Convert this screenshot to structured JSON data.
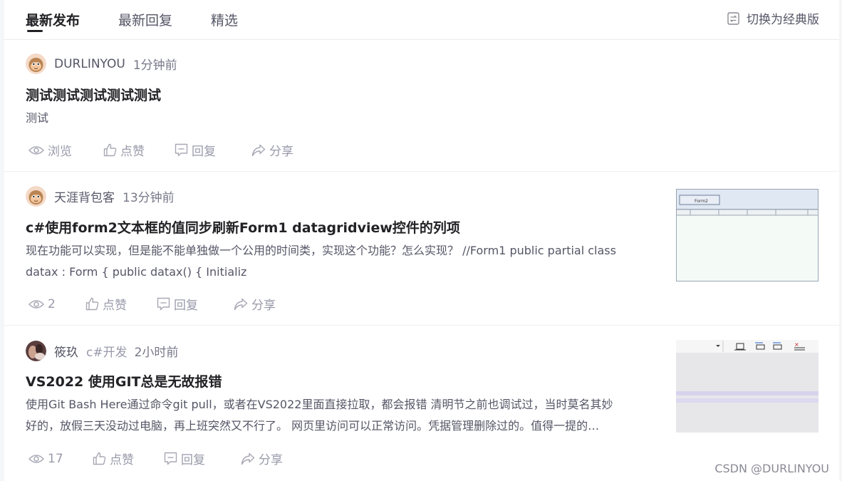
{
  "tabs": [
    "最新发布",
    "最新回复",
    "精选"
  ],
  "switch_label": "切换为经典版",
  "posts": [
    {
      "author": "DURLINYOU",
      "topic": "",
      "time": "1分钟前",
      "title": "测试测试测试测试测试",
      "excerpt": "测试",
      "views": "浏览",
      "like": "点赞",
      "reply": "回复",
      "share": "分享"
    },
    {
      "author": "天涯背包客",
      "topic": "",
      "time": "13分钟前",
      "title": "c#使用form2文本框的值同步刷新Form1 datagridview控件的列项",
      "excerpt_line1": "现在功能可以实现，但是能不能单独做一个公用的时间类，实现这个功能？怎么实现？ //Form1 public partial class",
      "excerpt_line2": "datax : Form { public datax() { Initializ",
      "views": "2",
      "like": "点赞",
      "reply": "回复",
      "share": "分享",
      "thumb_button": "Form2"
    },
    {
      "author": "筱玖",
      "topic": "c#开发",
      "time": "2小时前",
      "title": "VS2022 使用GIT总是无故报错",
      "excerpt_line1": "使用Git Bash Here通过命令git pull，或者在VS2022里面直接拉取，都会报错 清明节之前也调试过，当时莫名其妙",
      "excerpt_line2": "好的，放假三天没动过电脑，再上班突然又不行了。 网页里访问可以正常访问。凭据管理删除过的。值得一提的…",
      "views": "17",
      "like": "点赞",
      "reply": "回复",
      "share": "分享"
    }
  ],
  "watermark": "CSDN @DURLINYOU",
  "colors": {
    "text": "#222226",
    "secondary": "#555666",
    "muted": "#999aaa",
    "background": "#f5f6f7"
  },
  "icons": [
    "switch-icon",
    "eye-icon",
    "thumbs-up-icon",
    "comment-icon",
    "share-icon"
  ]
}
